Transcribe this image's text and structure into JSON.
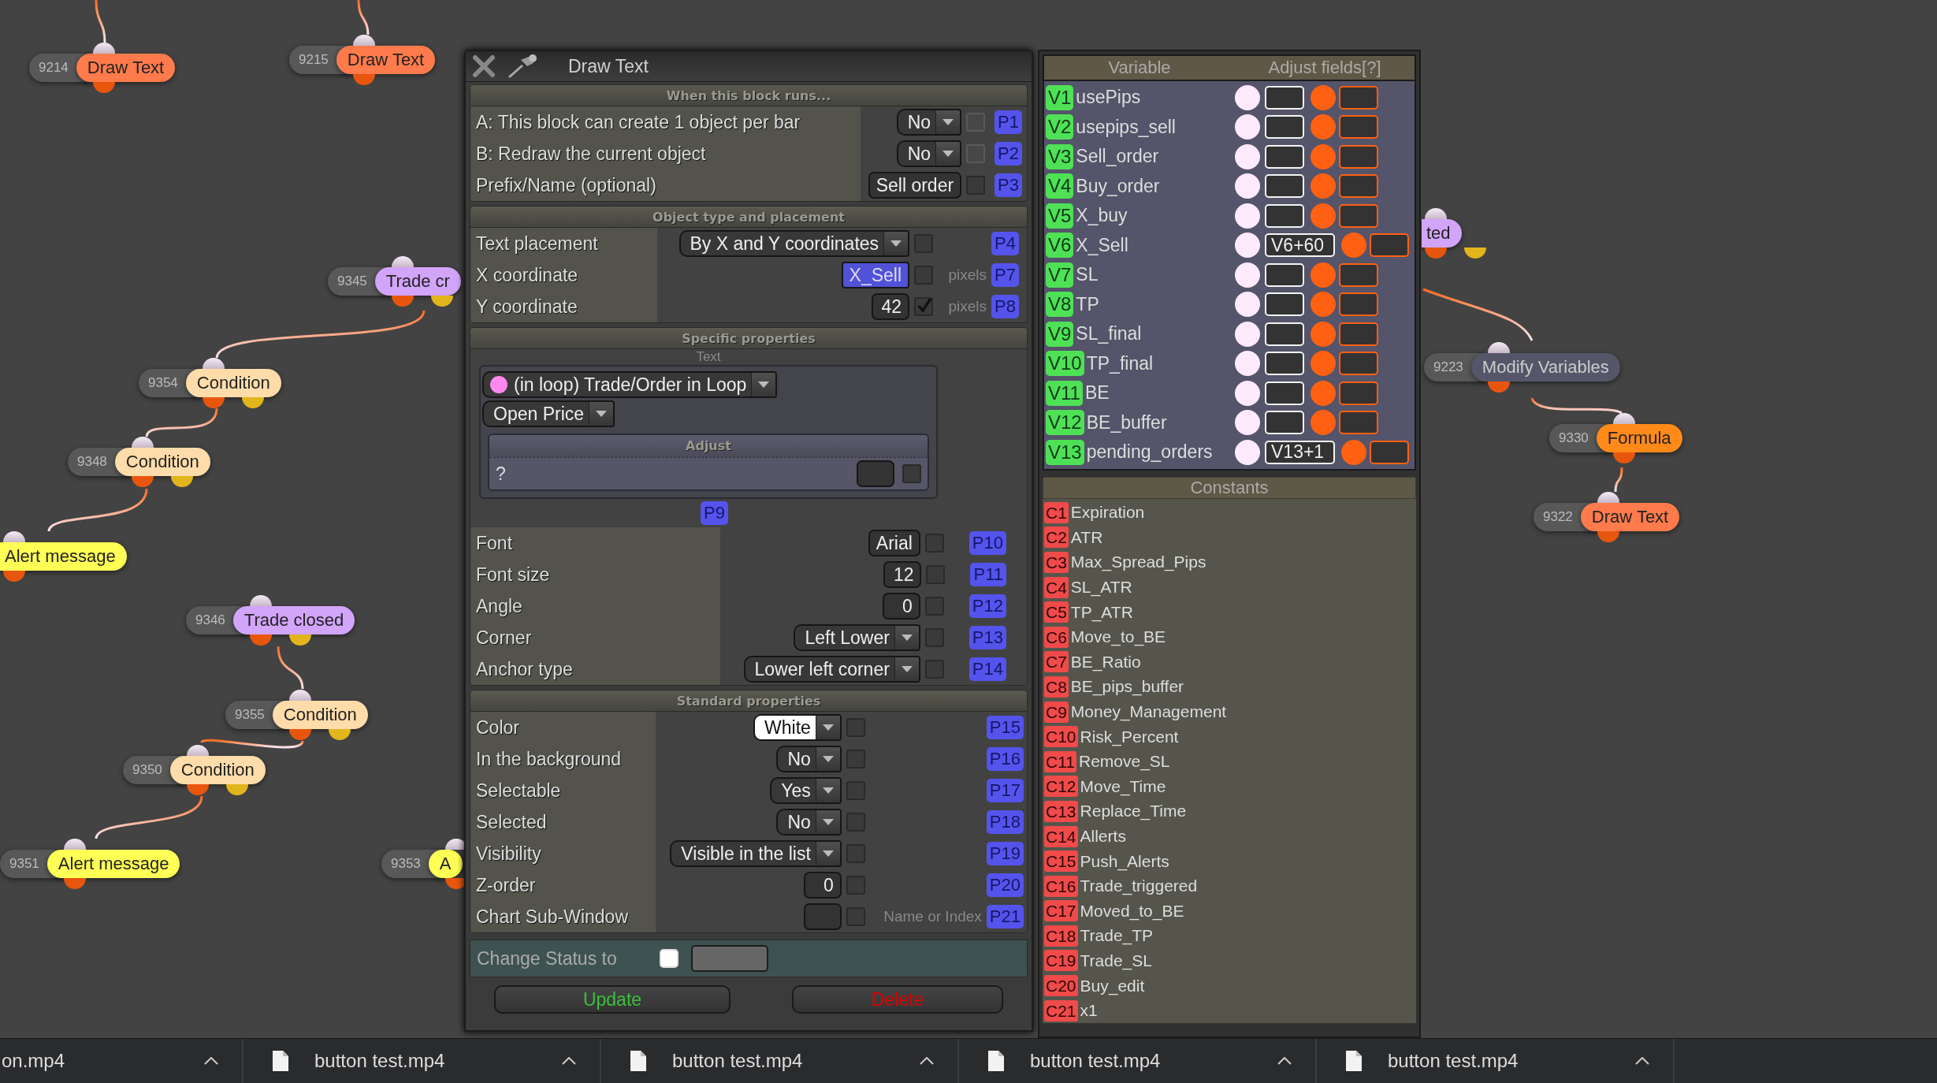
{
  "canvas": {
    "nodes": [
      {
        "id": "9214",
        "label": "Draw Text",
        "kind": "action",
        "color": "#ff7b4c"
      },
      {
        "id": "9215",
        "label": "Draw Text",
        "kind": "action",
        "color": "#ff7b4c"
      },
      {
        "id": "9345",
        "label": "Trade cr",
        "kind": "event",
        "color": "#d2a4fa"
      },
      {
        "id": "9354",
        "label": "Condition",
        "kind": "condition",
        "color": "#ffdcaa"
      },
      {
        "id": "9348",
        "label": "Condition",
        "kind": "condition",
        "color": "#ffdcaa"
      },
      {
        "label": "Alert message",
        "kind": "action",
        "color": "#ffff55"
      },
      {
        "id": "9346",
        "label": "Trade closed",
        "kind": "event",
        "color": "#d2a4fa"
      },
      {
        "id": "9355",
        "label": "Condition",
        "kind": "condition",
        "color": "#ffdcaa"
      },
      {
        "id": "9350",
        "label": "Condition",
        "kind": "condition",
        "color": "#ffdcaa"
      },
      {
        "id": "9351",
        "label": "Alert message",
        "kind": "action",
        "color": "#ffff55"
      },
      {
        "id": "9353",
        "label": "A",
        "kind": "action",
        "color": "#ffff55"
      },
      {
        "label": "ted",
        "kind": "event",
        "color": "#d2a4fa"
      },
      {
        "id": "9223",
        "label": "Modify Variables",
        "kind": "action",
        "color": "#56566a"
      },
      {
        "id": "9330",
        "label": "Formula",
        "kind": "action",
        "color": "#ff8a1a"
      },
      {
        "id": "9322",
        "label": "Draw Text",
        "kind": "action",
        "color": "#ff7b4c"
      }
    ]
  },
  "dialog": {
    "title": "Draw Text",
    "sections": [
      {
        "title": "When this block runs...",
        "rows": [
          {
            "label": "A: This block can create 1 object per bar",
            "kind": "dropdown",
            "value": "No",
            "checked": false,
            "enabled": false,
            "param": "P1"
          },
          {
            "label": "B: Redraw the current object",
            "kind": "dropdown",
            "value": "No",
            "checked": false,
            "enabled": false,
            "param": "P2"
          },
          {
            "label": "Prefix/Name (optional)",
            "kind": "input",
            "value": "Sell order",
            "checked": false,
            "enabled": true,
            "param": "P3"
          }
        ]
      },
      {
        "title": "Object type and placement",
        "rows": [
          {
            "label": "Text placement",
            "kind": "dropdown",
            "value": "By X and Y coordinates",
            "checked": false,
            "enabled": true,
            "param": "P4"
          },
          {
            "label": "X coordinate",
            "kind": "variable",
            "value": "X_Sell",
            "checked": false,
            "enabled": true,
            "unit": "pixels",
            "param": "P7"
          },
          {
            "label": "Y coordinate",
            "kind": "input",
            "value": "42",
            "checked": true,
            "enabled": true,
            "unit": "pixels",
            "param": "P8"
          }
        ]
      },
      {
        "title": "Specific properties",
        "subtitle": "Text",
        "source": {
          "label": "(in loop) Trade/Order in Loop",
          "color": "#ff88f0"
        },
        "field": "Open Price",
        "adjust": {
          "title": "Adjust",
          "label": "?",
          "checked": false
        },
        "param": "P9",
        "rows": [
          {
            "label": "Font",
            "kind": "input",
            "value": "Arial",
            "checked": false,
            "enabled": true,
            "param": "P10"
          },
          {
            "label": "Font size",
            "kind": "input",
            "value": "12",
            "checked": false,
            "enabled": true,
            "param": "P11"
          },
          {
            "label": "Angle",
            "kind": "input",
            "value": "0",
            "checked": false,
            "enabled": true,
            "param": "P12"
          },
          {
            "label": "Corner",
            "kind": "dropdown",
            "value": "Left Lower",
            "checked": false,
            "enabled": true,
            "param": "P13"
          },
          {
            "label": "Anchor type",
            "kind": "dropdown",
            "value": "Lower left corner",
            "checked": false,
            "enabled": true,
            "param": "P14"
          }
        ]
      },
      {
        "title": "Standard properties",
        "rows": [
          {
            "label": "Color",
            "kind": "color",
            "value": "White",
            "color": "#ffffff",
            "checked": false,
            "enabled": true,
            "param": "P15"
          },
          {
            "label": "In the background",
            "kind": "dropdown",
            "value": "No",
            "checked": false,
            "enabled": true,
            "param": "P16"
          },
          {
            "label": "Selectable",
            "kind": "dropdown",
            "value": "Yes",
            "checked": false,
            "enabled": true,
            "param": "P17"
          },
          {
            "label": "Selected",
            "kind": "dropdown",
            "value": "No",
            "checked": false,
            "enabled": true,
            "param": "P18"
          },
          {
            "label": "Visibility",
            "kind": "dropdown",
            "value": "Visible in the list",
            "checked": false,
            "enabled": true,
            "param": "P19"
          },
          {
            "label": "Z-order",
            "kind": "input",
            "value": "0",
            "checked": false,
            "enabled": true,
            "param": "P20"
          },
          {
            "label": "Chart Sub-Window",
            "kind": "input",
            "checked": false,
            "enabled": true,
            "hint": "Name or Index",
            "param": "P21"
          }
        ]
      }
    ],
    "change_status": {
      "label": "Change Status to",
      "checked": false
    },
    "buttons": [
      {
        "label": "Update",
        "kind": "update"
      },
      {
        "label": "Delete",
        "kind": "delete"
      }
    ]
  },
  "variables": {
    "columns": [
      "Variable",
      "Adjust fields[?]"
    ],
    "rows": [
      {
        "badge": "V1",
        "name": "usePips"
      },
      {
        "badge": "V2",
        "name": "usepips_sell"
      },
      {
        "badge": "V3",
        "name": "Sell_order"
      },
      {
        "badge": "V4",
        "name": "Buy_order"
      },
      {
        "badge": "V5",
        "name": "X_buy"
      },
      {
        "badge": "V6",
        "name": "X_Sell",
        "adjust": "V6+60"
      },
      {
        "badge": "V7",
        "name": "SL"
      },
      {
        "badge": "V8",
        "name": "TP"
      },
      {
        "badge": "V9",
        "name": "SL_final"
      },
      {
        "badge": "V10",
        "name": "TP_final"
      },
      {
        "badge": "V11",
        "name": "BE"
      },
      {
        "badge": "V12",
        "name": "BE_buffer"
      },
      {
        "badge": "V13",
        "name": "pending_orders",
        "adjust": "V13+1"
      }
    ]
  },
  "constants": {
    "title": "Constants",
    "rows": [
      {
        "badge": "C1",
        "name": "Expiration"
      },
      {
        "badge": "C2",
        "name": "ATR"
      },
      {
        "badge": "C3",
        "name": "Max_Spread_Pips"
      },
      {
        "badge": "C4",
        "name": "SL_ATR"
      },
      {
        "badge": "C5",
        "name": "TP_ATR"
      },
      {
        "badge": "C6",
        "name": "Move_to_BE"
      },
      {
        "badge": "C7",
        "name": "BE_Ratio"
      },
      {
        "badge": "C8",
        "name": "BE_pips_buffer"
      },
      {
        "badge": "C9",
        "name": "Money_Management"
      },
      {
        "badge": "C10",
        "name": "Risk_Percent"
      },
      {
        "badge": "C11",
        "name": "Remove_SL"
      },
      {
        "badge": "C12",
        "name": "Move_Time"
      },
      {
        "badge": "C13",
        "name": "Replace_Time"
      },
      {
        "badge": "C14",
        "name": "Allerts"
      },
      {
        "badge": "C15",
        "name": "Push_Alerts"
      },
      {
        "badge": "C16",
        "name": "Trade_triggered"
      },
      {
        "badge": "C17",
        "name": "Moved_to_BE"
      },
      {
        "badge": "C18",
        "name": "Trade_TP"
      },
      {
        "badge": "C19",
        "name": "Trade_SL"
      },
      {
        "badge": "C20",
        "name": "Buy_edit"
      },
      {
        "badge": "C21",
        "name": "x1"
      }
    ]
  },
  "taskbar": {
    "items": [
      {
        "label": "on.mp4",
        "file_icon": false
      },
      {
        "label": "button test.mp4",
        "file_icon": true
      },
      {
        "label": "button test.mp4",
        "file_icon": true
      },
      {
        "label": "button test.mp4",
        "file_icon": true
      },
      {
        "label": "button test.mp4",
        "file_icon": true
      }
    ]
  }
}
